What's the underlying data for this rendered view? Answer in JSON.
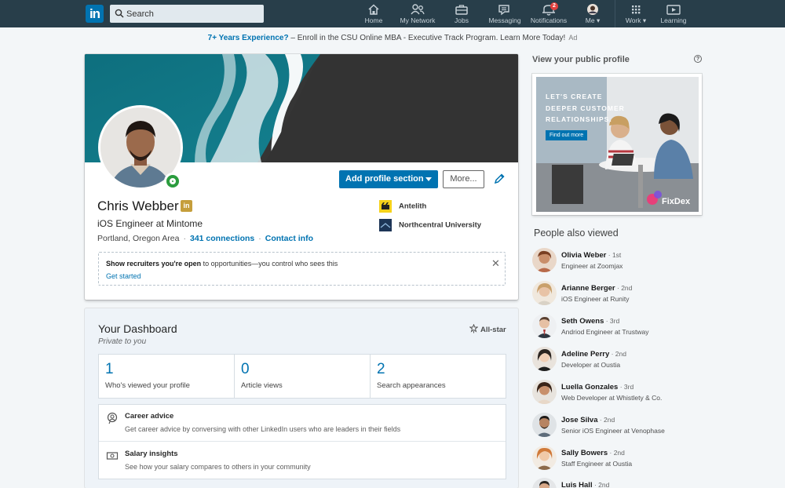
{
  "nav": {
    "search_placeholder": "Search",
    "items": [
      {
        "label": "Home",
        "icon": "home-icon"
      },
      {
        "label": "My Network",
        "icon": "network-icon"
      },
      {
        "label": "Jobs",
        "icon": "jobs-icon"
      },
      {
        "label": "Messaging",
        "icon": "messaging-icon"
      },
      {
        "label": "Notifications",
        "icon": "notifications-icon",
        "badge": "2"
      },
      {
        "label": "Me",
        "icon": "avatar"
      },
      {
        "label": "Work",
        "icon": "grid-icon"
      },
      {
        "label": "Learning",
        "icon": "learning-icon"
      }
    ]
  },
  "ad_line": {
    "link": "7+ Years Experience?",
    "text": " – Enroll in the CSU Online MBA - Executive Track Program. Learn More Today!",
    "tag": "Ad"
  },
  "profile": {
    "name": "Chris Webber",
    "headline": "iOS Engineer at Mintome",
    "location": "Portland, Oregon Area",
    "connections": "341 connections",
    "contact": "Contact info",
    "add_section": "Add profile section",
    "more": "More...",
    "experience": [
      {
        "org": "Antelith"
      },
      {
        "org": "Northcentral University"
      }
    ],
    "open_box": {
      "bold": "Show recruiters you're open",
      "rest": " to opportunities—you control who sees this",
      "link": "Get started"
    }
  },
  "dashboard": {
    "title": "Your Dashboard",
    "subtitle": "Private to you",
    "allstar": "All-star",
    "stats": [
      {
        "value": "1",
        "label": "Who's viewed your profile"
      },
      {
        "value": "0",
        "label": "Article views"
      },
      {
        "value": "2",
        "label": "Search appearances"
      }
    ],
    "advice": [
      {
        "title": "Career advice",
        "desc": "Get career advice by conversing with other LinkedIn users who are leaders in their fields"
      },
      {
        "title": "Salary insights",
        "desc": "See how your salary compares to others in your community"
      }
    ]
  },
  "rail": {
    "public_profile": "View your public profile",
    "help": "?",
    "ad": {
      "line1": "LET'S CREATE",
      "line2": "DEEPER CUSTOMER",
      "line3": "RELATIONSHIPS.",
      "cta": "Find out more",
      "brand": "FixDex"
    },
    "people_title": "People also viewed",
    "people": [
      {
        "name": "Olivia Weber",
        "degree": " · 1st",
        "title": "Engineer at Zoomjax"
      },
      {
        "name": "Arianne Berger",
        "degree": " · 2nd",
        "title": "iOS Engineer at Runity"
      },
      {
        "name": "Seth Owens",
        "degree": " · 3rd",
        "title": "Andriod Engineer at Trustway"
      },
      {
        "name": "Adeline Perry",
        "degree": " · 2nd",
        "title": "Developer at Oustia"
      },
      {
        "name": "Luella Gonzales",
        "degree": " · 3rd",
        "title": "Web Developer at Whistlety & Co."
      },
      {
        "name": "Jose Silva",
        "degree": " · 2nd",
        "title": "Senior iOS Engineer at Venophase"
      },
      {
        "name": "Sally Bowers",
        "degree": " · 2nd",
        "title": "Staff Engineer at Oustia"
      },
      {
        "name": "Luis Hall",
        "degree": " · 2nd",
        "title": ""
      }
    ]
  },
  "colors": {
    "nav_bg": "#283e4a",
    "brand_blue": "#0073b1",
    "page_bg": "#f3f6f8",
    "badge_red": "#e2403e",
    "open_green": "#2b9c3e"
  }
}
